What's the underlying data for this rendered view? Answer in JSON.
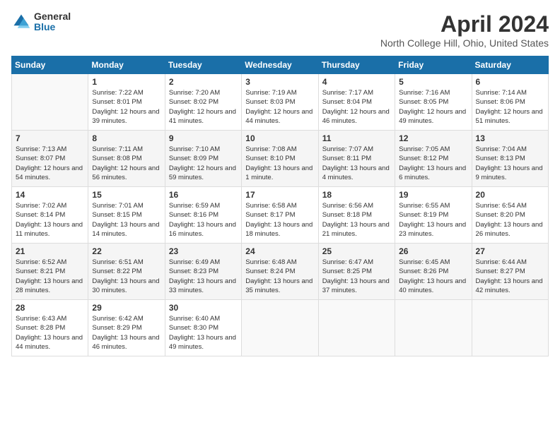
{
  "header": {
    "logo_general": "General",
    "logo_blue": "Blue",
    "title": "April 2024",
    "subtitle": "North College Hill, Ohio, United States"
  },
  "days_of_week": [
    "Sunday",
    "Monday",
    "Tuesday",
    "Wednesday",
    "Thursday",
    "Friday",
    "Saturday"
  ],
  "weeks": [
    [
      {
        "day": "",
        "sunrise": "",
        "sunset": "",
        "daylight": ""
      },
      {
        "day": "1",
        "sunrise": "Sunrise: 7:22 AM",
        "sunset": "Sunset: 8:01 PM",
        "daylight": "Daylight: 12 hours and 39 minutes."
      },
      {
        "day": "2",
        "sunrise": "Sunrise: 7:20 AM",
        "sunset": "Sunset: 8:02 PM",
        "daylight": "Daylight: 12 hours and 41 minutes."
      },
      {
        "day": "3",
        "sunrise": "Sunrise: 7:19 AM",
        "sunset": "Sunset: 8:03 PM",
        "daylight": "Daylight: 12 hours and 44 minutes."
      },
      {
        "day": "4",
        "sunrise": "Sunrise: 7:17 AM",
        "sunset": "Sunset: 8:04 PM",
        "daylight": "Daylight: 12 hours and 46 minutes."
      },
      {
        "day": "5",
        "sunrise": "Sunrise: 7:16 AM",
        "sunset": "Sunset: 8:05 PM",
        "daylight": "Daylight: 12 hours and 49 minutes."
      },
      {
        "day": "6",
        "sunrise": "Sunrise: 7:14 AM",
        "sunset": "Sunset: 8:06 PM",
        "daylight": "Daylight: 12 hours and 51 minutes."
      }
    ],
    [
      {
        "day": "7",
        "sunrise": "Sunrise: 7:13 AM",
        "sunset": "Sunset: 8:07 PM",
        "daylight": "Daylight: 12 hours and 54 minutes."
      },
      {
        "day": "8",
        "sunrise": "Sunrise: 7:11 AM",
        "sunset": "Sunset: 8:08 PM",
        "daylight": "Daylight: 12 hours and 56 minutes."
      },
      {
        "day": "9",
        "sunrise": "Sunrise: 7:10 AM",
        "sunset": "Sunset: 8:09 PM",
        "daylight": "Daylight: 12 hours and 59 minutes."
      },
      {
        "day": "10",
        "sunrise": "Sunrise: 7:08 AM",
        "sunset": "Sunset: 8:10 PM",
        "daylight": "Daylight: 13 hours and 1 minute."
      },
      {
        "day": "11",
        "sunrise": "Sunrise: 7:07 AM",
        "sunset": "Sunset: 8:11 PM",
        "daylight": "Daylight: 13 hours and 4 minutes."
      },
      {
        "day": "12",
        "sunrise": "Sunrise: 7:05 AM",
        "sunset": "Sunset: 8:12 PM",
        "daylight": "Daylight: 13 hours and 6 minutes."
      },
      {
        "day": "13",
        "sunrise": "Sunrise: 7:04 AM",
        "sunset": "Sunset: 8:13 PM",
        "daylight": "Daylight: 13 hours and 9 minutes."
      }
    ],
    [
      {
        "day": "14",
        "sunrise": "Sunrise: 7:02 AM",
        "sunset": "Sunset: 8:14 PM",
        "daylight": "Daylight: 13 hours and 11 minutes."
      },
      {
        "day": "15",
        "sunrise": "Sunrise: 7:01 AM",
        "sunset": "Sunset: 8:15 PM",
        "daylight": "Daylight: 13 hours and 14 minutes."
      },
      {
        "day": "16",
        "sunrise": "Sunrise: 6:59 AM",
        "sunset": "Sunset: 8:16 PM",
        "daylight": "Daylight: 13 hours and 16 minutes."
      },
      {
        "day": "17",
        "sunrise": "Sunrise: 6:58 AM",
        "sunset": "Sunset: 8:17 PM",
        "daylight": "Daylight: 13 hours and 18 minutes."
      },
      {
        "day": "18",
        "sunrise": "Sunrise: 6:56 AM",
        "sunset": "Sunset: 8:18 PM",
        "daylight": "Daylight: 13 hours and 21 minutes."
      },
      {
        "day": "19",
        "sunrise": "Sunrise: 6:55 AM",
        "sunset": "Sunset: 8:19 PM",
        "daylight": "Daylight: 13 hours and 23 minutes."
      },
      {
        "day": "20",
        "sunrise": "Sunrise: 6:54 AM",
        "sunset": "Sunset: 8:20 PM",
        "daylight": "Daylight: 13 hours and 26 minutes."
      }
    ],
    [
      {
        "day": "21",
        "sunrise": "Sunrise: 6:52 AM",
        "sunset": "Sunset: 8:21 PM",
        "daylight": "Daylight: 13 hours and 28 minutes."
      },
      {
        "day": "22",
        "sunrise": "Sunrise: 6:51 AM",
        "sunset": "Sunset: 8:22 PM",
        "daylight": "Daylight: 13 hours and 30 minutes."
      },
      {
        "day": "23",
        "sunrise": "Sunrise: 6:49 AM",
        "sunset": "Sunset: 8:23 PM",
        "daylight": "Daylight: 13 hours and 33 minutes."
      },
      {
        "day": "24",
        "sunrise": "Sunrise: 6:48 AM",
        "sunset": "Sunset: 8:24 PM",
        "daylight": "Daylight: 13 hours and 35 minutes."
      },
      {
        "day": "25",
        "sunrise": "Sunrise: 6:47 AM",
        "sunset": "Sunset: 8:25 PM",
        "daylight": "Daylight: 13 hours and 37 minutes."
      },
      {
        "day": "26",
        "sunrise": "Sunrise: 6:45 AM",
        "sunset": "Sunset: 8:26 PM",
        "daylight": "Daylight: 13 hours and 40 minutes."
      },
      {
        "day": "27",
        "sunrise": "Sunrise: 6:44 AM",
        "sunset": "Sunset: 8:27 PM",
        "daylight": "Daylight: 13 hours and 42 minutes."
      }
    ],
    [
      {
        "day": "28",
        "sunrise": "Sunrise: 6:43 AM",
        "sunset": "Sunset: 8:28 PM",
        "daylight": "Daylight: 13 hours and 44 minutes."
      },
      {
        "day": "29",
        "sunrise": "Sunrise: 6:42 AM",
        "sunset": "Sunset: 8:29 PM",
        "daylight": "Daylight: 13 hours and 46 minutes."
      },
      {
        "day": "30",
        "sunrise": "Sunrise: 6:40 AM",
        "sunset": "Sunset: 8:30 PM",
        "daylight": "Daylight: 13 hours and 49 minutes."
      },
      {
        "day": "",
        "sunrise": "",
        "sunset": "",
        "daylight": ""
      },
      {
        "day": "",
        "sunrise": "",
        "sunset": "",
        "daylight": ""
      },
      {
        "day": "",
        "sunrise": "",
        "sunset": "",
        "daylight": ""
      },
      {
        "day": "",
        "sunrise": "",
        "sunset": "",
        "daylight": ""
      }
    ]
  ]
}
